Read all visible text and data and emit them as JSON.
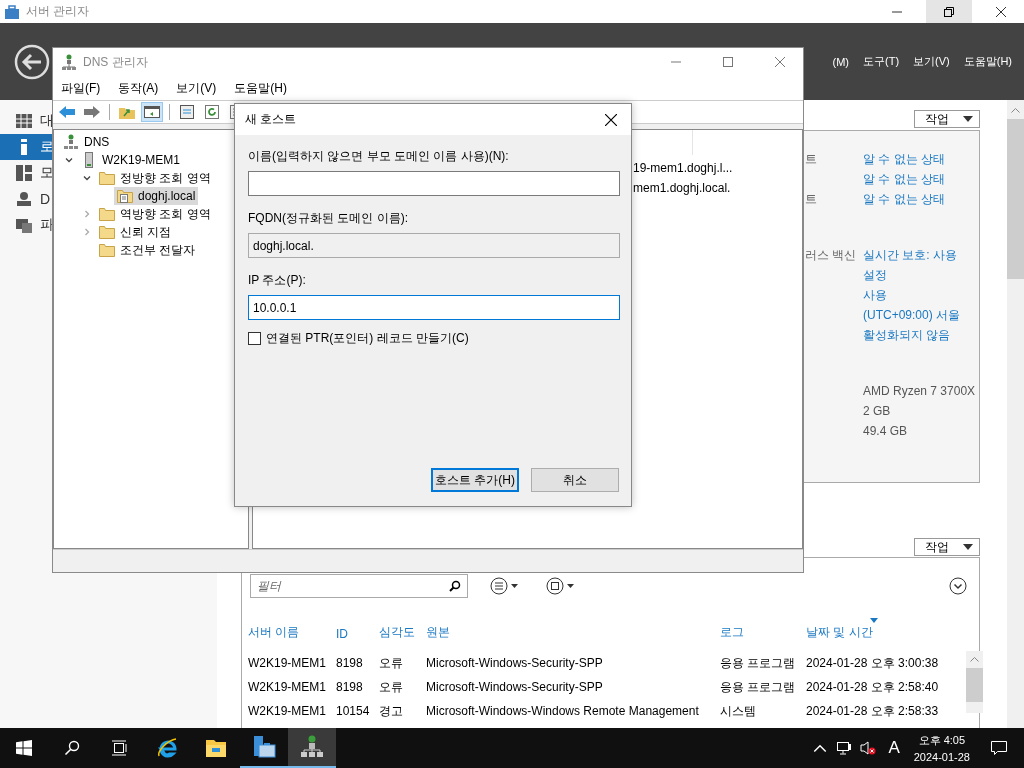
{
  "server_manager": {
    "title": "서버 관리자",
    "menu": [
      "(M)",
      "도구(T)",
      "보기(V)",
      "도움말(H)"
    ],
    "nav": [
      {
        "label": "대",
        "kind": "dashboard",
        "selected": false
      },
      {
        "label": "로",
        "kind": "local",
        "selected": true
      },
      {
        "label": "모",
        "kind": "all",
        "selected": false
      },
      {
        "label": "D",
        "kind": "dns",
        "selected": false
      },
      {
        "label": "파",
        "kind": "files",
        "selected": false
      }
    ],
    "tasks_button": "작업",
    "property_groups": [
      [
        {
          "label": "트",
          "value": "알 수 없는 상태",
          "link": true
        },
        {
          "value": "알 수 없는 상태",
          "link": true
        },
        {
          "label": "트",
          "value": "알 수 없는 상태",
          "link": true
        }
      ],
      [
        {
          "label": "러스 백신",
          "value": "실시간 보호: 사용",
          "link": true
        },
        {
          "value": "설정",
          "link": true
        },
        {
          "value": "사용",
          "link": true
        },
        {
          "value": "(UTC+09:00) 서울",
          "link": true
        },
        {
          "value": "활성화되지 않음",
          "link": true
        }
      ],
      [
        {
          "value": "AMD Ryzen 7 3700X",
          "link": false
        },
        {
          "value": "2 GB",
          "link": false
        },
        {
          "value": "49.4 GB",
          "link": false
        }
      ]
    ],
    "events": {
      "tasks_button": "작업",
      "filter_placeholder": "필터",
      "columns": [
        {
          "label": "서버 이름",
          "sorted": false
        },
        {
          "label": "ID",
          "sorted": false
        },
        {
          "label": "심각도",
          "sorted": false
        },
        {
          "label": "원본",
          "sorted": false
        },
        {
          "label": "로그",
          "sorted": false
        },
        {
          "label": "날짜 및 시간",
          "sorted": true
        }
      ],
      "rows": [
        [
          "W2K19-MEM1",
          "8198",
          "오류",
          "Microsoft-Windows-Security-SPP",
          "응용 프로그램",
          "2024-01-28 오후 3:00:38"
        ],
        [
          "W2K19-MEM1",
          "8198",
          "오류",
          "Microsoft-Windows-Security-SPP",
          "응용 프로그램",
          "2024-01-28 오후 2:58:40"
        ],
        [
          "W2K19-MEM1",
          "10154",
          "경고",
          "Microsoft-Windows-Windows Remote Management",
          "시스템",
          "2024-01-28 오후 2:58:33"
        ]
      ]
    }
  },
  "dns_manager": {
    "title": "DNS 관리자",
    "menu": [
      "파일(F)",
      "동작(A)",
      "보기(V)",
      "도움말(H)"
    ],
    "tree": [
      {
        "label": "DNS",
        "kind": "dns",
        "selected": false,
        "children": [
          {
            "label": "W2K19-MEM1",
            "kind": "server",
            "selected": false,
            "expanded": true,
            "children": [
              {
                "label": "정방향 조회 영역",
                "kind": "folder",
                "selected": false,
                "expanded": true,
                "children": [
                  {
                    "label": "doghj.local",
                    "kind": "zone",
                    "selected": true
                  }
                ]
              },
              {
                "label": "역방향 조회 영역",
                "kind": "folder",
                "selected": false,
                "expanded": false
              },
              {
                "label": "신뢰 지점",
                "kind": "folder",
                "selected": false,
                "expanded": false
              },
              {
                "label": "조건부 전달자",
                "kind": "folder",
                "selected": false
              }
            ]
          }
        ]
      }
    ],
    "list_items": [
      "19-mem1.doghj.l...",
      "mem1.doghj.local."
    ]
  },
  "dialog": {
    "title": "새 호스트",
    "fields": [
      {
        "label": "이름(입력하지 않으면 부모 도메인 이름 사용)(N):",
        "readonly": false,
        "focused": false
      },
      {
        "label": "FQDN(정규화된 도메인 이름):",
        "value": "doghj.local.",
        "readonly": true,
        "focused": false
      },
      {
        "label": "IP 주소(P):",
        "value": "10.0.0.1",
        "readonly": false,
        "focused": true
      }
    ],
    "checkbox": {
      "label": "연결된 PTR(포인터) 레코드 만들기(C)",
      "checked": false
    },
    "buttons": [
      {
        "label": "호스트 추가(H)",
        "default": true
      },
      {
        "label": "취소",
        "default": false
      }
    ]
  },
  "taskbar": {
    "apps": [
      {
        "kind": "ie",
        "open": false,
        "selected": false
      },
      {
        "kind": "explorer",
        "open": false,
        "selected": false
      },
      {
        "kind": "server-manager",
        "open": true,
        "selected": false
      },
      {
        "kind": "dns",
        "open": true,
        "selected": true
      }
    ],
    "input_indicator": "A",
    "time": "오후 4:05",
    "date": "2024-01-28"
  }
}
